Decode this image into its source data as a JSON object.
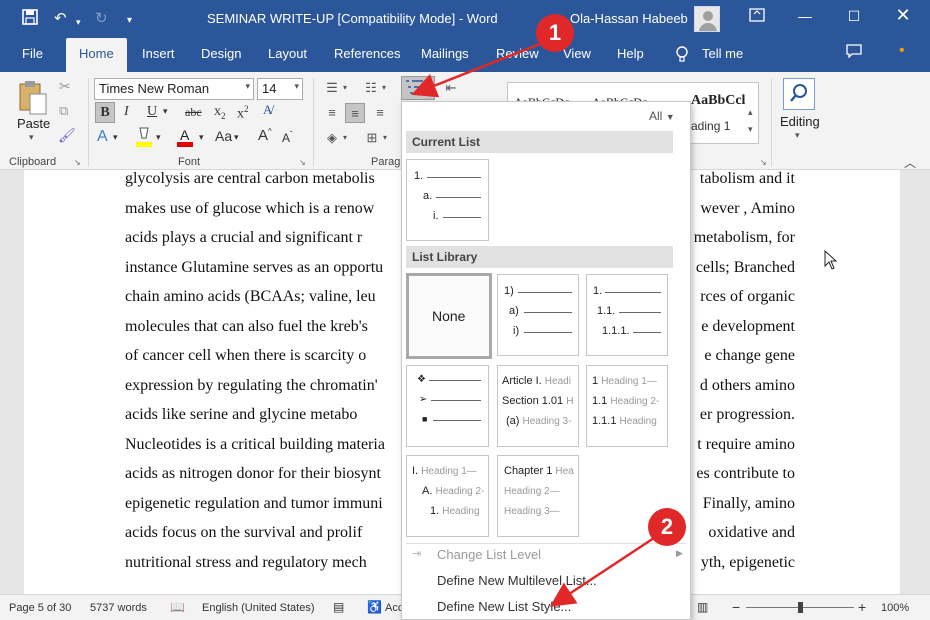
{
  "window": {
    "title": "SEMINAR WRITE-UP [Compatibility Mode]  -  Word",
    "user": "Ola-Hassan Habeeb"
  },
  "tabs": [
    "File",
    "Home",
    "Insert",
    "Design",
    "Layout",
    "References",
    "Mailings",
    "Review",
    "View",
    "Help",
    "Tell me"
  ],
  "ribbon": {
    "clipboard": {
      "paste": "Paste",
      "label": "Clipboard"
    },
    "font": {
      "name": "Times New Roman",
      "size": "14",
      "label": "Font"
    },
    "paragraph": {
      "label": "Paragra"
    },
    "styles": {
      "samples": [
        "AaBbCcDc",
        "AaBbCcDc",
        "AaBbCcl"
      ],
      "heading_partial": "ading 1"
    },
    "editing": {
      "label": "Editing"
    }
  },
  "document": {
    "lines": [
      "glycolysis are central carbon metabolis",
      "makes use of glucose which is a renow",
      "acids plays a crucial and significant r",
      "instance Glutamine serves as an opportu",
      "chain amino acids (BCAAs; valine, leu",
      "molecules that can also fuel the kreb's",
      "of cancer cell when there is scarcity o",
      "expression by regulating the chromatin'",
      "acids like serine and glycine metabo",
      "Nucleotides is a critical building materia",
      "acids as nitrogen donor for their biosynt",
      "epigenetic regulation and tumor immuni",
      "acids focus on the survival and prolif",
      "nutritional stress and regulatory mech"
    ],
    "lines_right": [
      "tabolism and it",
      "wever , Amino",
      "metabolism, for",
      "cells; Branched",
      "rces of organic",
      "e development",
      "e change gene",
      "d others amino",
      "er progression.",
      "t require amino",
      "es contribute to",
      "Finally, amino",
      "oxidative and",
      "yth, epigenetic"
    ]
  },
  "dropdown": {
    "filter": "All",
    "current_list_header": "Current List",
    "list_library_header": "List Library",
    "none_label": "None",
    "current_tile": [
      "1.",
      "a.",
      "i."
    ],
    "tile_paren": [
      "1)",
      "a)",
      "i)"
    ],
    "tile_decimal": [
      "1.",
      "1.1.",
      "1.1.1."
    ],
    "tile_article": {
      "a1": "Article I.",
      "a1h": "Headi",
      "a2": "Section 1.01",
      "a2h": "H",
      "a3": "(a)",
      "a3h": "Heading 3-"
    },
    "tile_heading_num": {
      "n1": "1",
      "n1h": "Heading 1—",
      "n2": "1.1",
      "n2h": "Heading 2-",
      "n3": "1.1.1",
      "n3h": "Heading"
    },
    "tile_roman": {
      "r1": "I.",
      "r1h": "Heading 1—",
      "r2": "A.",
      "r2h": "Heading 2-",
      "r3": "1.",
      "r3h": "Heading"
    },
    "tile_chapter": {
      "c1": "Chapter 1",
      "c1h": "Hea",
      "c2h": "Heading 2—",
      "c3h": "Heading 3—"
    },
    "menu_items": [
      "Change List Level",
      "Define New Multilevel List...",
      "Define New List Style..."
    ]
  },
  "callouts": [
    "1",
    "2"
  ],
  "status": {
    "page": "Page 5 of 30",
    "words": "5737 words",
    "language": "English (United States)",
    "acc_partial": "Acc",
    "zoom": "100%"
  },
  "colors": {
    "title_bar": "#2b579a",
    "ribbon": "#f3f3f3",
    "callout": "#e02828",
    "highlight_yellow": "#ffff00",
    "font_red": "#e00000"
  }
}
